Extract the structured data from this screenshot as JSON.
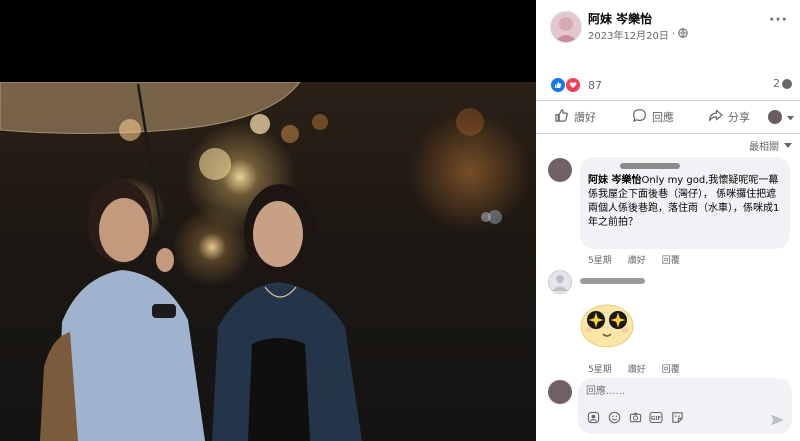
{
  "post": {
    "author": "阿妹 岑樂怡",
    "date": "2023年12月20日",
    "separator": "·",
    "more_label": "···",
    "reaction_count": "87",
    "comment_count": "2",
    "privacy_icon": "globe-icon"
  },
  "actions": {
    "like_label": "讚好",
    "comment_label": "回應",
    "share_label": "分享"
  },
  "sort_label": "最相關",
  "comments": [
    {
      "author": "阿妹 岑樂怡",
      "text": "Only my god,我懷疑呢呢一幕係我屋企下面後巷（灣仔）， 係咪攞住把遮兩個人係後巷跑，落住雨（水車），係咪成1年之前拍？",
      "time": "5星期",
      "like_label": "讚好",
      "reply_label": "回覆"
    },
    {
      "sticker": "laughing-star-eyes-sticker",
      "time": "5星期",
      "like_label": "讚好",
      "reply_label": "回覆"
    }
  ],
  "composer": {
    "placeholder": "回應......"
  },
  "colors": {
    "like_blue": "#1877f2",
    "love_red": "#f33e58",
    "meta_gray": "#65676b",
    "bubble_bg": "#f0f2f5"
  }
}
